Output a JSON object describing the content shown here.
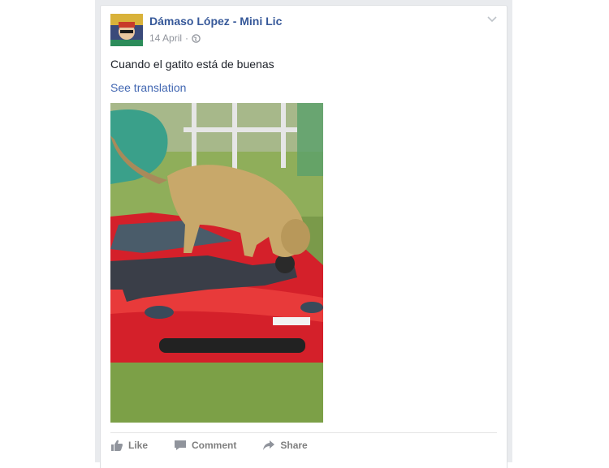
{
  "post": {
    "author": "Dámaso López - Mini Lic",
    "date": "14 April",
    "separator": "·",
    "audience_icon": "globe-icon",
    "text": "Cuando el gatito está de buenas",
    "see_translation": "See translation"
  },
  "actions": {
    "like": "Like",
    "comment": "Comment",
    "share": "Share"
  },
  "colors": {
    "link": "#365899",
    "translate": "#4267b2",
    "meta": "#90949c",
    "action": "#7f7f7f"
  }
}
